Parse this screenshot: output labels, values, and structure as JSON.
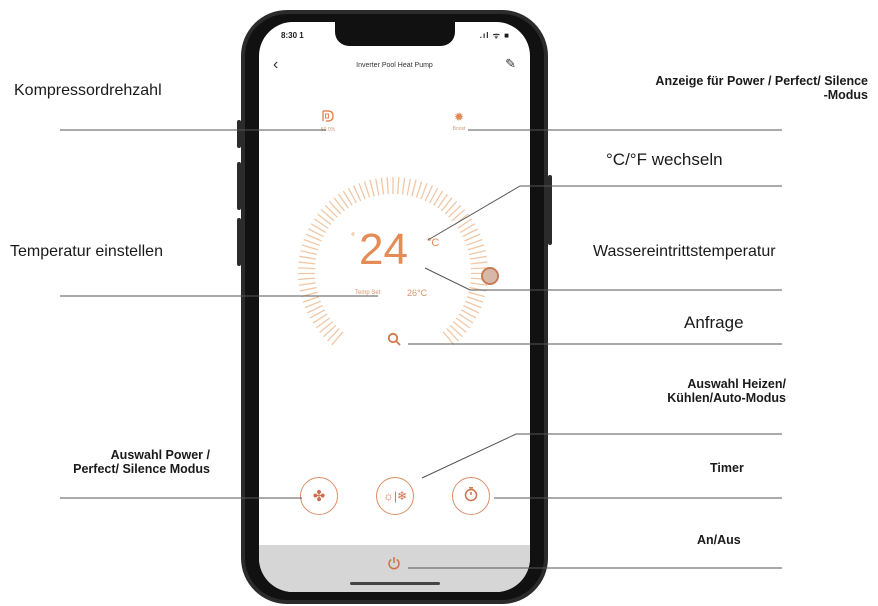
{
  "annotations": {
    "compressor_speed": "Kompressordrehzahl",
    "mode_display_line1": "Anzeige für Power / Perfect/ Silence",
    "mode_display_line2": "-Modus",
    "unit_switch": "°C/°F  wechseln",
    "set_temperature": "Temperatur einstellen",
    "water_inlet_temperature": "Wassereintrittstemperatur",
    "query": "Anfrage",
    "heat_cool_auto_line1": "Auswahl Heizen/",
    "heat_cool_auto_line2": "Kühlen/Auto-Modus",
    "power_mode_line1": "Auswahl Power /",
    "power_mode_line2": "Perfect/ Silence Modus",
    "timer": "Timer",
    "on_off": "An/Aus"
  },
  "phone": {
    "status_time": "8:30 1",
    "status_icons": ".ıl ᯤ ■",
    "app_title": "Inverter Pool Heat Pump",
    "compressor_value": "50.0%",
    "mode_value": "Boost",
    "temperature": "24",
    "temperature_unit": "°C",
    "temperature_unit_left": "°",
    "temp_set_label": "Temp Set",
    "water_temperature": "26°C"
  },
  "icons": {
    "back": "chevron-left-icon",
    "edit": "pencil-icon",
    "compressor": "compressor-icon",
    "mode": "sun-icon",
    "query": "search-icon",
    "fan": "fan-icon",
    "heat_cool": "sun-snowflake-icon",
    "timer": "timer-icon",
    "power": "power-icon"
  },
  "colors": {
    "accent": "#e58b55",
    "dial_tick": "#f0c7a6",
    "footer": "#d6d6d6"
  }
}
